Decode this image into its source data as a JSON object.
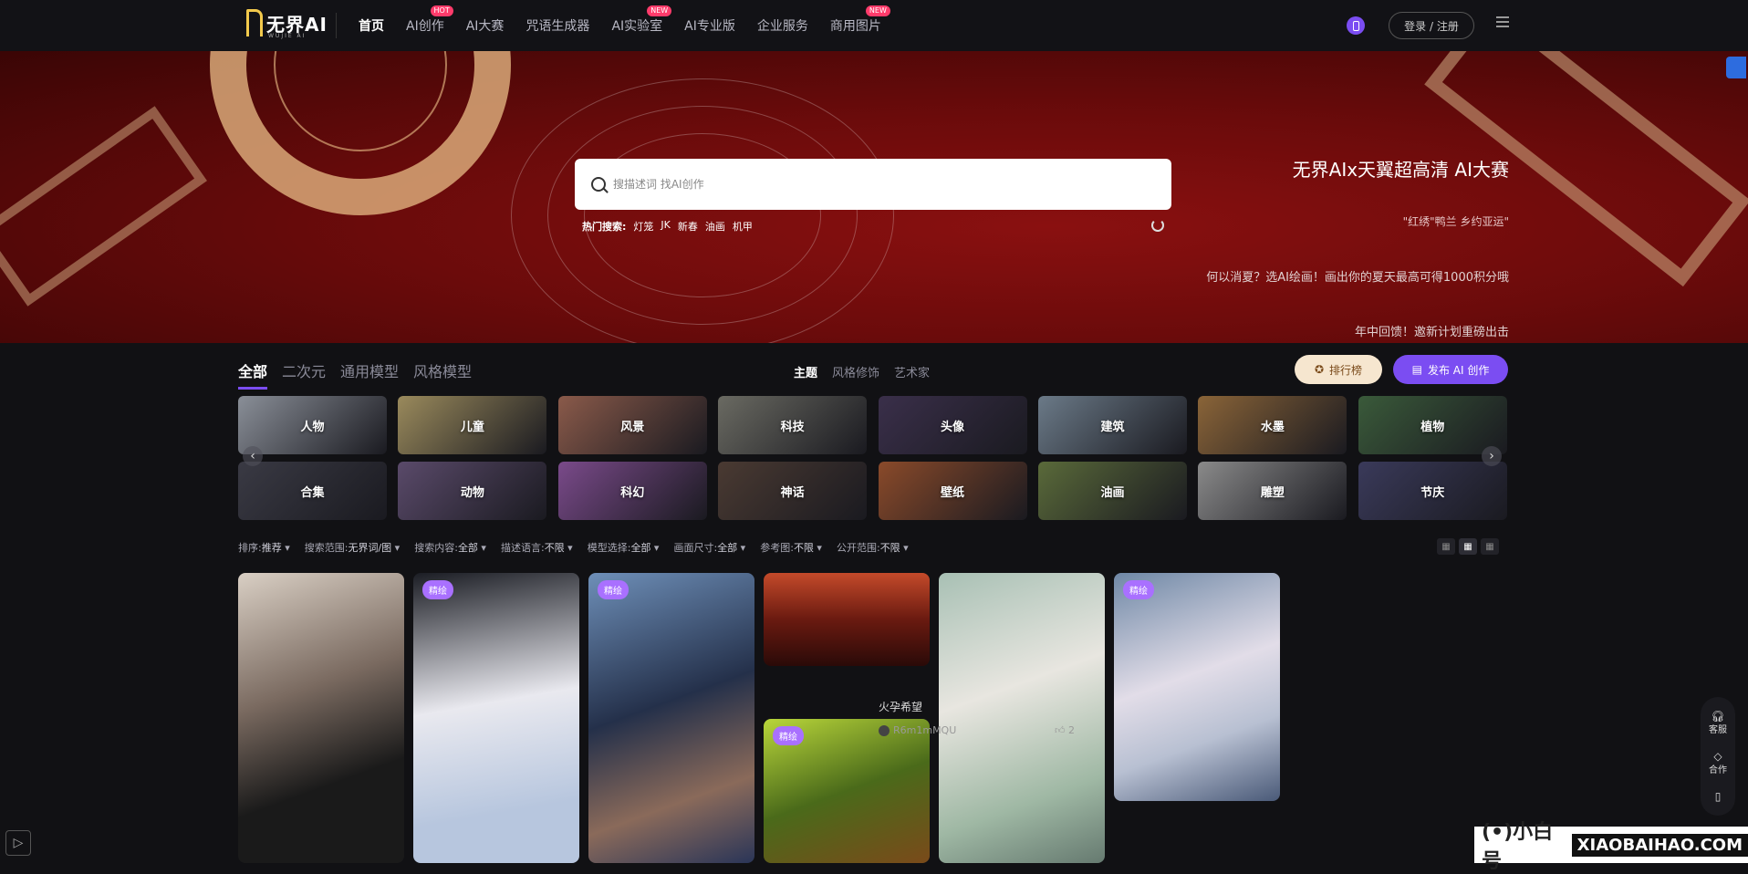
{
  "header": {
    "logo_text": "无界AI",
    "logo_sub": "WUJIE AI",
    "nav": [
      {
        "label": "首页",
        "active": true
      },
      {
        "label": "AI创作",
        "badge": "HOT"
      },
      {
        "label": "AI大赛"
      },
      {
        "label": "咒语生成器"
      },
      {
        "label": "AI实验室",
        "badge": "NEW"
      },
      {
        "label": "AI专业版"
      },
      {
        "label": "企业服务"
      },
      {
        "label": "商用图片",
        "badge": "NEW"
      }
    ],
    "login_label": "登录 / 注册"
  },
  "hero": {
    "search_placeholder": "搜描述词 找AI创作",
    "hot_label": "热门搜索:",
    "hot_terms": [
      "灯笼",
      "JK",
      "新春",
      "油画",
      "机甲"
    ],
    "title": "无界AIx天翼超高清 AI大赛",
    "sub1": "\"红绣\"鸭兰 乡约亚运\"",
    "sub2": "何以消夏？选AI绘画！画出你的夏天最高可得1000积分哦",
    "sub3": "年中回馈！邀新计划重磅出击"
  },
  "tabs": {
    "main": [
      {
        "label": "全部",
        "active": true
      },
      {
        "label": "二次元"
      },
      {
        "label": "通用模型"
      },
      {
        "label": "风格模型"
      }
    ],
    "sub": [
      {
        "label": "主题",
        "active": true
      },
      {
        "label": "风格修饰"
      },
      {
        "label": "艺术家"
      }
    ],
    "rank_label": "排行榜",
    "publish_label": "发布 AI 创作"
  },
  "categories": [
    {
      "label": "人物",
      "color": "#8a8f98"
    },
    {
      "label": "儿童",
      "color": "#9a8a5c"
    },
    {
      "label": "风景",
      "color": "#8a5a4a"
    },
    {
      "label": "科技",
      "color": "#6a6a62"
    },
    {
      "label": "头像",
      "color": "#3a2f4a"
    },
    {
      "label": "建筑",
      "color": "#6b7a88"
    },
    {
      "label": "水墨",
      "color": "#8a6438"
    },
    {
      "label": "植物",
      "color": "#3a5a3a"
    },
    {
      "label": "合集",
      "color": "#3a3a44"
    },
    {
      "label": "动物",
      "color": "#5a4a6a"
    },
    {
      "label": "科幻",
      "color": "#7a4a8a"
    },
    {
      "label": "神话",
      "color": "#4a3a32"
    },
    {
      "label": "壁纸",
      "color": "#8a4a2a"
    },
    {
      "label": "油画",
      "color": "#5a6a3a"
    },
    {
      "label": "雕塑",
      "color": "#8a8a8a"
    },
    {
      "label": "节庆",
      "color": "#3a3a5a"
    }
  ],
  "filters": [
    {
      "label": "排序:",
      "value": "推荐"
    },
    {
      "label": "搜索范围:",
      "value": "无界词/图"
    },
    {
      "label": "搜索内容:",
      "value": "全部"
    },
    {
      "label": "描述语言:",
      "value": "不限"
    },
    {
      "label": "模型选择:",
      "value": "全部"
    },
    {
      "label": "画面尺寸:",
      "value": "全部"
    },
    {
      "label": "参考图:",
      "value": "不限"
    },
    {
      "label": "公开范围:",
      "value": "不限"
    }
  ],
  "gallery": {
    "badge_label": "精绘",
    "card_title": "火孕希望",
    "card_author": "R6m1mMQU",
    "card_likes": "2"
  },
  "side_float": {
    "service": "客服",
    "cooperate": "合作"
  },
  "watermark": {
    "logo": "(•)小白号",
    "text": "XIAOBAIHAO.COM"
  }
}
